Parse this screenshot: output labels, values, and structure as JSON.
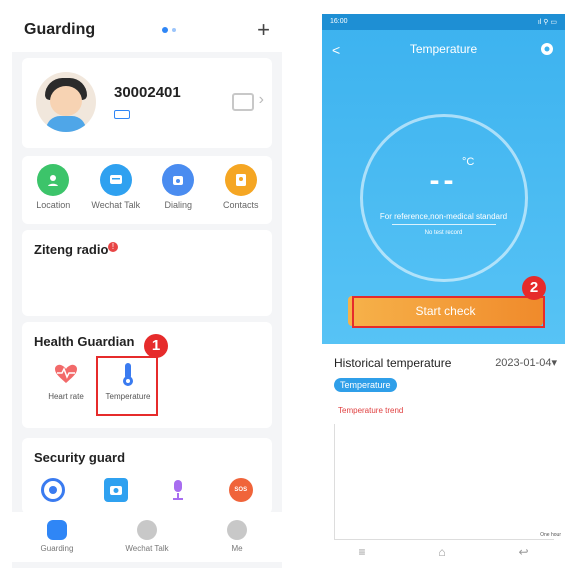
{
  "left": {
    "header": {
      "title": "Guarding",
      "plus": "+"
    },
    "profile": {
      "device_id": "30002401",
      "chevron": "›"
    },
    "quick_actions": [
      {
        "label": "Location",
        "icon": "location-icon",
        "color": "#3cc46a"
      },
      {
        "label": "Wechat Talk",
        "icon": "chat-icon",
        "color": "#2fa1f0"
      },
      {
        "label": "Dialing",
        "icon": "phone-icon",
        "color": "#4a8cf0"
      },
      {
        "label": "Contacts",
        "icon": "contacts-icon",
        "color": "#f5a623"
      }
    ],
    "radio": {
      "title": "Ziteng radio",
      "dot": "!"
    },
    "health": {
      "title": "Health Guardian",
      "items": [
        {
          "label": "Heart rate",
          "icon": "heart-rate-icon"
        },
        {
          "label": "Temperature",
          "icon": "thermometer-icon"
        }
      ],
      "step_badge": "1"
    },
    "security": {
      "title": "Security guard",
      "icons": [
        {
          "icon": "guard-icon",
          "color": "#3a7bf0"
        },
        {
          "icon": "camera-icon",
          "color": "#2fa1f0"
        },
        {
          "icon": "mic-icon",
          "color": "#a86df0"
        },
        {
          "icon": "sos-icon",
          "color": "#f0643a",
          "text": "SOS"
        }
      ]
    },
    "bottom_nav": [
      {
        "label": "Guarding",
        "color": "#2f86f6"
      },
      {
        "label": "Wechat Talk",
        "color": "#c8c8c8"
      },
      {
        "label": "Me",
        "color": "#c8c8c8"
      }
    ]
  },
  "right": {
    "status": {
      "time": "16:00",
      "right": "ıl ⚲ ▭"
    },
    "header": {
      "title": "Temperature",
      "back": "<"
    },
    "reading": {
      "value": "--",
      "unit": "°C",
      "reference": "For reference,non-medical standard",
      "no_record": "No test record"
    },
    "start_button": "Start check",
    "step_badge": "2",
    "history": {
      "title": "Historical temperature",
      "date": "2023-01-04",
      "caret": "▾",
      "tag": "Temperature",
      "trend": "Temperature trend",
      "one_hour": "One hour"
    },
    "sysnav": [
      "≡",
      "⌂",
      "↩"
    ]
  }
}
